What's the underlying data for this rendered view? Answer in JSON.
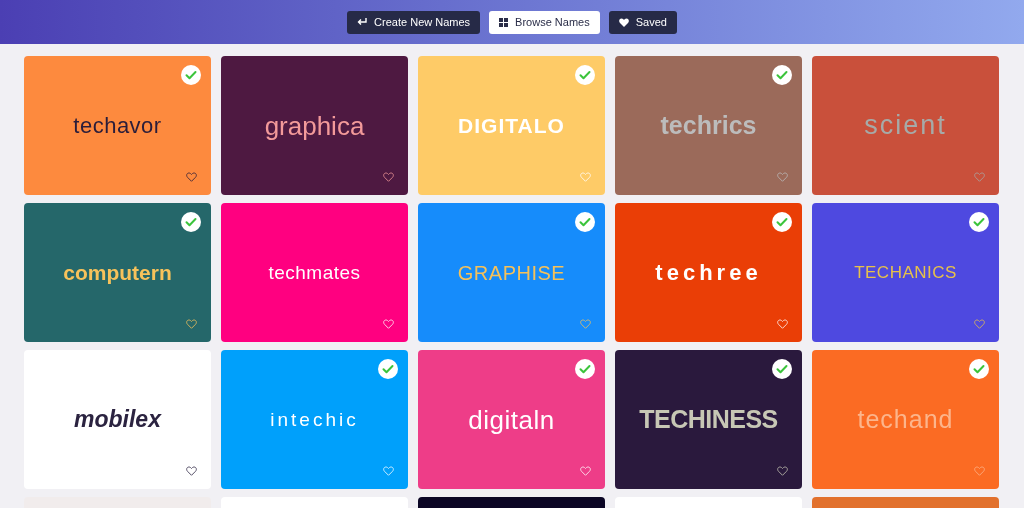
{
  "nav": [
    {
      "label": "Create New Names",
      "selected": false
    },
    {
      "label": "Browse Names",
      "selected": true
    },
    {
      "label": "Saved",
      "selected": false
    }
  ],
  "cards": [
    {
      "name": "techavor",
      "color": "#fd8a3e",
      "checked": true
    },
    {
      "name": "graphica",
      "color": "#4e1941",
      "checked": false
    },
    {
      "name": "DIGITALO",
      "color": "#fecb67",
      "checked": true
    },
    {
      "name": "techrics",
      "color": "#9b6a5a",
      "checked": true
    },
    {
      "name": "scient",
      "color": "#c9503b",
      "checked": false
    },
    {
      "name": "computern",
      "color": "#25676a",
      "checked": true
    },
    {
      "name": "techmates",
      "color": "#ff0080",
      "checked": false
    },
    {
      "name": "GRAPHISE",
      "color": "#168cfb",
      "checked": true
    },
    {
      "name": "techree",
      "color": "#ea3e06",
      "checked": true
    },
    {
      "name": "TECHANICS",
      "color": "#4e49e0",
      "checked": true
    },
    {
      "name": "mobilex",
      "color": "#ffffff",
      "checked": false
    },
    {
      "name": "intechic",
      "color": "#00a0fb",
      "checked": true
    },
    {
      "name": "digitaln",
      "color": "#ee3d88",
      "checked": true
    },
    {
      "name": "TECHINESS",
      "color": "#2a193d",
      "checked": true
    },
    {
      "name": "techand",
      "color": "#fb6b23",
      "checked": true
    },
    {
      "color": "#f1ecec"
    },
    {
      "color": "#ffffff"
    },
    {
      "color": "#0b0625"
    },
    {
      "color": "#ffffff"
    },
    {
      "color": "#e2712d"
    }
  ]
}
